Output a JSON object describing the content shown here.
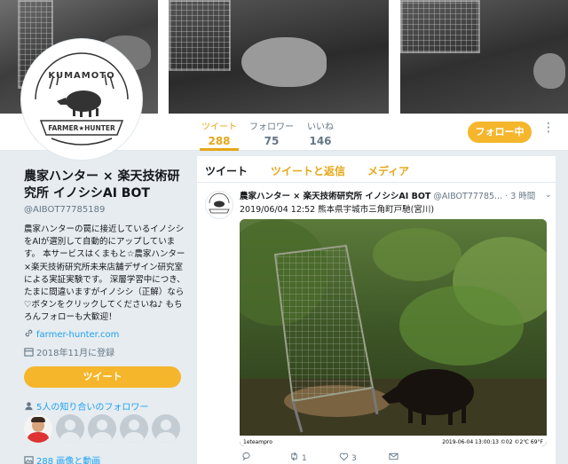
{
  "profile": {
    "name": "農家ハンター × 楽天技術研究所 イノシシAI BOT",
    "handle": "@AIBOT77785189",
    "bio": "農家ハンターの罠に接近しているイノシシをAIが選別して自動的にアップしています。 本サービスはくまもと☆農家ハンター×楽天技術研究所未来店舗デザイン研究室 による実証実験です。 深層学習中につき、たまに間違いますがイノシシ（正解）なら♡ボタンをクリックしてくださいね♪ もちろんフォローも大歓迎！",
    "link": "farmer-hunter.com",
    "joined": "2018年11月に登録",
    "tweet_button": "ツイート",
    "followers_you_know": "5人の知り合いのフォロワー",
    "media": "288 画像と動画"
  },
  "logo": {
    "top_text": "KUMAMOTO",
    "bottom_text": "FARMER★HUNTER"
  },
  "stats": [
    {
      "label": "ツイート",
      "value": "288"
    },
    {
      "label": "フォロワー",
      "value": "75"
    },
    {
      "label": "いいね",
      "value": "146"
    }
  ],
  "follow_button": "フォロー中",
  "tabs": [
    {
      "label": "ツイート"
    },
    {
      "label": "ツイートと返信"
    },
    {
      "label": "メディア"
    }
  ],
  "tweet": {
    "name": "農家ハンター × 楽天技術研究所 イノシシAI BOT",
    "handle": "@AIBOT77785...",
    "time": "· 3 時間",
    "text": "2019/06/04 12:52 熊本県宇城市三角町戸馳(宮川)",
    "photo_footer_left": "1eteampro",
    "photo_footer_right": "2019-06-04 13:00:13 ©02 ©2℃ 69°F",
    "reply_count": "",
    "retweet_count": "1",
    "like_count": "3"
  },
  "colors": {
    "accent": "#f5b62c",
    "accent_text": "#e6a717",
    "link": "#1da1f2",
    "muted": "#657786"
  }
}
